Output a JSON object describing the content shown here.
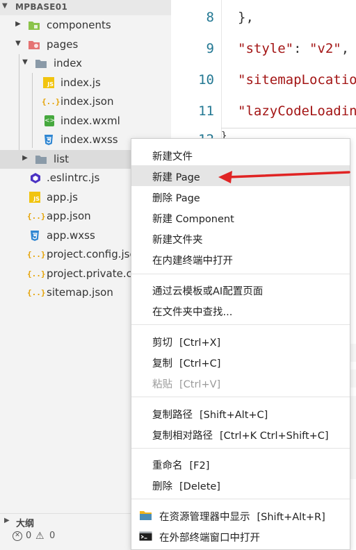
{
  "explorer": {
    "project_title": "MPBASE01",
    "tree": [
      {
        "label": "components",
        "type": "folder-green",
        "expanded": false
      },
      {
        "label": "pages",
        "type": "folder-red",
        "expanded": true
      },
      {
        "label": "index",
        "type": "folder",
        "expanded": true
      },
      {
        "label": "index.js",
        "type": "js",
        "icon_text": "JS"
      },
      {
        "label": "index.json",
        "type": "json",
        "icon_text": "{..}"
      },
      {
        "label": "index.wxml",
        "type": "wxml",
        "icon_text": "<>"
      },
      {
        "label": "index.wxss",
        "type": "wxss"
      },
      {
        "label": "list",
        "type": "folder",
        "expanded": false
      },
      {
        "label": ".eslintrc.js",
        "type": "eslint"
      },
      {
        "label": "app.js",
        "type": "js",
        "icon_text": "JS"
      },
      {
        "label": "app.json",
        "type": "json",
        "icon_text": "{..}"
      },
      {
        "label": "app.wxss",
        "type": "wxss"
      },
      {
        "label": "project.config.json",
        "type": "json",
        "icon_text": "{..}"
      },
      {
        "label": "project.private.config.json",
        "type": "json",
        "icon_text": "{..}"
      },
      {
        "label": "sitemap.json",
        "type": "json",
        "icon_text": "{..}"
      }
    ],
    "outline_title": "大纲",
    "status": {
      "errors": "0",
      "warnings": "0",
      "error_glyph": "✕",
      "warning_glyph": "⚠"
    }
  },
  "editor": {
    "line_numbers": [
      "8",
      "9",
      "10",
      "11",
      "12"
    ],
    "lines": [
      {
        "punc_open": "}",
        "str": "",
        "punc_close": ","
      },
      {
        "punc_open": "",
        "str": "\"style\"",
        "punc_close": ": ",
        "str2": "\"v2\"",
        "tail": ","
      },
      {
        "punc_open": "",
        "str": "\"sitemapLocation\"",
        "punc_close": "",
        "str2": "",
        "tail": ""
      },
      {
        "punc_open": "",
        "str": "\"lazyCodeLoading\"",
        "punc_close": "",
        "str2": "",
        "tail": ""
      }
    ],
    "line_12_fragment": "}"
  },
  "context_menu": {
    "groups": [
      [
        {
          "label": "新建文件"
        },
        {
          "label": "新建 Page",
          "hover": true
        },
        {
          "label": "删除 Page"
        },
        {
          "label": "新建 Component"
        },
        {
          "label": "新建文件夹"
        },
        {
          "label": "在内建终端中打开"
        }
      ],
      [
        {
          "label": "通过云模板或AI配置页面"
        },
        {
          "label": "在文件夹中查找..."
        }
      ],
      [
        {
          "label": "剪切",
          "shortcut": "[Ctrl+X]"
        },
        {
          "label": "复制",
          "shortcut": "[Ctrl+C]"
        },
        {
          "label": "粘贴",
          "shortcut": "[Ctrl+V]",
          "disabled": true
        }
      ],
      [
        {
          "label": "复制路径",
          "shortcut": "[Shift+Alt+C]"
        },
        {
          "label": "复制相对路径",
          "shortcut": "[Ctrl+K Ctrl+Shift+C]"
        }
      ],
      [
        {
          "label": "重命名",
          "shortcut": "[F2]"
        },
        {
          "label": "删除",
          "shortcut": "[Delete]"
        }
      ],
      [
        {
          "label": "在资源管理器中显示",
          "shortcut": "[Shift+Alt+R]",
          "icon": "folder-icon"
        },
        {
          "label": "在外部终端窗口中打开",
          "icon": "terminal-icon"
        }
      ]
    ]
  },
  "colors": {
    "arrow": "#e02424",
    "hover_bg": "#e5e5e5",
    "string": "#a31515",
    "line_number": "#237893"
  }
}
